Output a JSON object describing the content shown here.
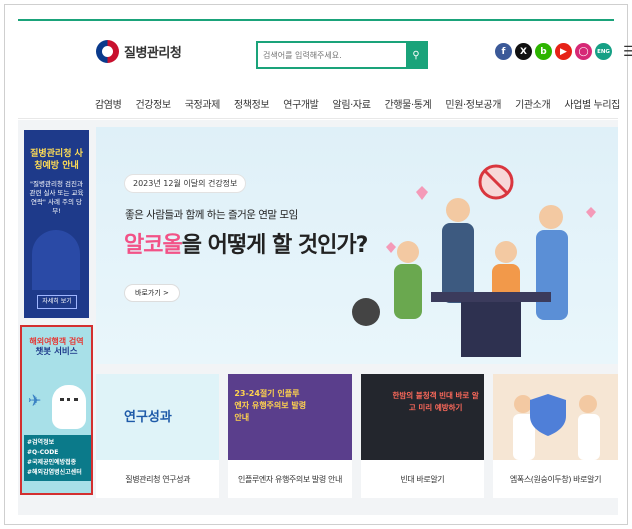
{
  "header": {
    "logo_text": "질병관리청",
    "search_placeholder": "검색어를 입력해주세요.",
    "social_icons": [
      "facebook-icon",
      "x-icon",
      "blog-icon",
      "youtube-icon",
      "instagram-icon",
      "eng-icon"
    ],
    "eng_label": "ENG",
    "menu_icon": "hamburger-menu-icon"
  },
  "nav": {
    "items": [
      "감염병",
      "건강정보",
      "국정과제",
      "정책정보",
      "연구개발",
      "알림·자료",
      "간행물·통계",
      "민원·정보공개",
      "기관소개",
      "사업별 누리집"
    ]
  },
  "side_promo_1": {
    "title": "질병관리청 사칭예방 안내",
    "text": "\"질병관리청 검진과 관련 실사 또는 교육 연락\" 사례 주의 당부!",
    "button": "자세히 보기"
  },
  "side_promo_2": {
    "title_line1": "해외여행객 검역",
    "title_line2": "챗봇 서비스",
    "tags": [
      "#검역정보",
      "#Q-CODE",
      "#국제공인예방접종",
      "#해외감염병신고센터"
    ]
  },
  "banner": {
    "date_label": "2023년 12월 이달의 건강정보",
    "subtitle": "좋은 사람들과 함께 하는 즐거운 연말 모임",
    "title_highlight": "알코올",
    "title_rest": "을 어떻게 할 것인가?",
    "button": "바로가기 >"
  },
  "cards": [
    {
      "caption": "연구성과",
      "label": "질병관리청 연구성과"
    },
    {
      "caption": "23-24절기 인플루엔자 유행주의보 발령 안내",
      "label": "인플루엔자 유행주의보 발령 안내"
    },
    {
      "caption": "한밤의 불청객 빈대 바로 알고 미리 예방하기",
      "label": "빈대 바로알기"
    },
    {
      "caption": "",
      "label": "엠폭스(원숭이두창) 바로알기"
    }
  ],
  "colors": {
    "accent": "#1aa37a",
    "highlight": "#f25287",
    "promo_navy": "#1e3a8a",
    "promo_border": "#d32f2f"
  }
}
